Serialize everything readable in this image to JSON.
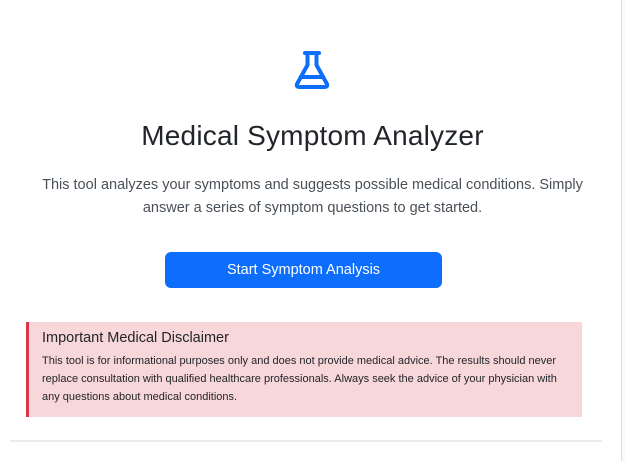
{
  "app": {
    "icon": "flask-icon",
    "accent_color": "#0d6efd",
    "title": "Medical Symptom Analyzer",
    "subtitle": "This tool analyzes your symptoms and suggests possible medical conditions. Simply answer a series of symptom questions to get started.",
    "start_button_label": "Start Symptom Analysis"
  },
  "disclaimer": {
    "title": "Important Medical Disclaimer",
    "text": "This tool is for informational purposes only and does not provide medical advice. The results should never replace consultation with qualified healthcare professionals. Always seek the advice of your physician with any questions about medical conditions.",
    "background_color": "#f8d7da",
    "border_color": "#dc3545"
  }
}
